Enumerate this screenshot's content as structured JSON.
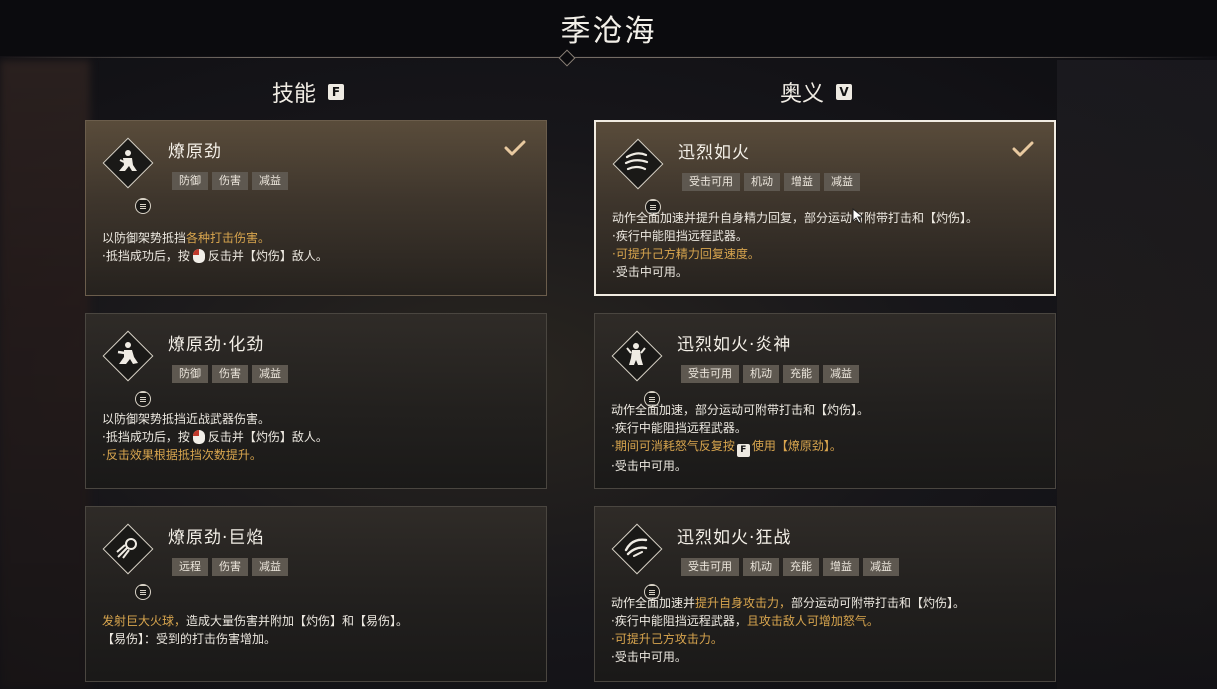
{
  "header": {
    "title": "季沧海"
  },
  "skills": {
    "title": "技能",
    "key": "F",
    "cards": [
      {
        "name": "燎原劲",
        "tags": [
          "防御",
          "伤害",
          "减益"
        ],
        "equipped": true,
        "line1_a": "以防御架势抵挡",
        "line1_b": "各种打击伤害。",
        "line2_a": "·抵挡成功后，按",
        "line2_b": "反击并【灼伤】敌人。",
        "icon": "crouching-figure-icon"
      },
      {
        "name": "燎原劲·化劲",
        "tags": [
          "防御",
          "伤害",
          "减益"
        ],
        "equipped": false,
        "line1": "以防御架势抵挡近战武器伤害。",
        "line2_a": "·抵挡成功后，按",
        "line2_b": "反击并【灼伤】敌人。",
        "line3": "·反击效果根据抵挡次数提升。",
        "icon": "guard-stance-icon"
      },
      {
        "name": "燎原劲·巨焰",
        "tags": [
          "远程",
          "伤害",
          "减益"
        ],
        "equipped": false,
        "line1_a": "发射巨大火球，",
        "line1_b": "造成大量伤害并附加【灼伤】和【易伤】。",
        "line2": "【易伤】：受到的打击伤害增加。",
        "icon": "fireball-icon"
      }
    ]
  },
  "ultimates": {
    "title": "奥义",
    "key": "V",
    "cards": [
      {
        "name": "迅烈如火",
        "tags": [
          "受击可用",
          "机动",
          "增益",
          "减益"
        ],
        "equipped": true,
        "selected": true,
        "line1": "动作全面加速并提升自身精力回复，部分运动可附带打击和【灼伤】。",
        "line2": "·疾行中能阻挡远程武器。",
        "line3": "·可提升己方精力回复速度。",
        "line4": "·受击中可用。",
        "icon": "dash-claw-icon"
      },
      {
        "name": "迅烈如火·炎神",
        "tags": [
          "受击可用",
          "机动",
          "充能",
          "减益"
        ],
        "equipped": false,
        "line1": "动作全面加速，部分运动可附带打击和【灼伤】。",
        "line2": "·疾行中能阻挡远程武器。",
        "line3_a": "·期间可消耗怒气反复按",
        "line3_key": "F",
        "line3_b": "使用【燎原劲】。",
        "line4": "·受击中可用。",
        "icon": "flame-deity-icon"
      },
      {
        "name": "迅烈如火·狂战",
        "tags": [
          "受击可用",
          "机动",
          "充能",
          "增益",
          "减益"
        ],
        "equipped": false,
        "line1_a": "动作全面加速并",
        "line1_b": "提升自身攻击力，",
        "line1_c": "部分运动可附带打击和【灼伤】。",
        "line2_a": "·疾行中能阻挡远程武器，",
        "line2_b": "且攻击敌人可增加怒气。",
        "line3": "·可提升己方攻击力。",
        "line4": "·受击中可用。",
        "icon": "frenzy-slash-icon"
      }
    ]
  }
}
